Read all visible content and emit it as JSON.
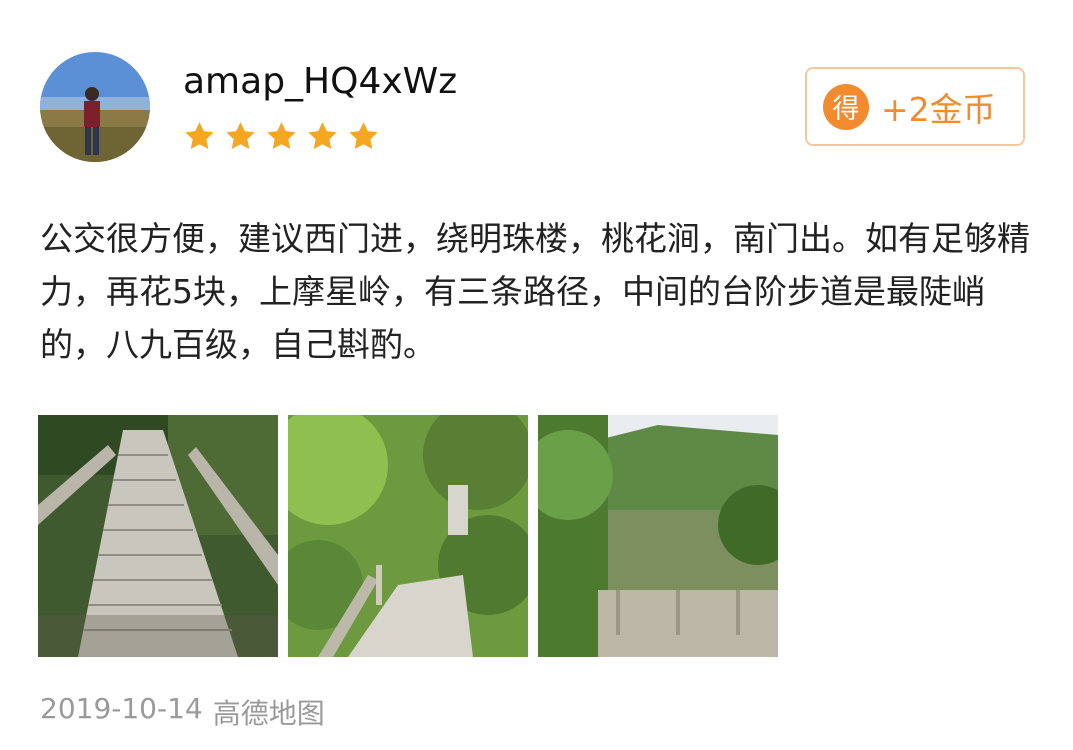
{
  "review": {
    "user": {
      "name": "amap_HQ4xWz",
      "avatar_icon": "user-avatar-photo"
    },
    "rating": {
      "stars": 5,
      "max": 5,
      "color": "#f5a623"
    },
    "reward": {
      "icon_text": "得",
      "label": "+2金币",
      "color": "#f28a2e"
    },
    "text": "公交很方便，建议西门进，绕明珠楼，桃花涧，南门出。如有足够精力，再花5块，上摩星岭，有三条路径，中间的台阶步道是最陡峭的，八九百级，自己斟酌。",
    "photos": [
      {
        "icon": "stone-stairs-photo"
      },
      {
        "icon": "forest-path-photo"
      },
      {
        "icon": "lake-bridge-photo"
      }
    ],
    "date": "2019-10-14",
    "source": "高德地图"
  }
}
